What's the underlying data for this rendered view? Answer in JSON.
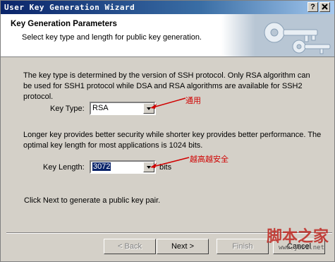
{
  "window": {
    "title": "User Key Generation Wizard",
    "help_btn": "?",
    "close_btn": "X"
  },
  "header": {
    "title": "Key Generation Parameters",
    "subtitle": "Select key type and length for public key generation."
  },
  "content": {
    "paragraph1": "The key type is determined by the version of SSH protocol. Only RSA algorithm can be used for SSH1 protocol while DSA and RSA algorithms are available for SSH2 protocol.",
    "key_type_label": "Key Type:",
    "key_type_value": "RSA",
    "annotation1": "通用",
    "paragraph2": "Longer key provides better security while shorter key provides better performance. The optimal key length for most applications is 1024 bits.",
    "key_length_label": "Key Length:",
    "key_length_value": "3072",
    "key_length_unit": "bits",
    "annotation2": "越高越安全",
    "footer_text": "Click Next to generate a public key pair."
  },
  "buttons": {
    "back": "< Back",
    "next": "Next >",
    "finish": "Finish",
    "cancel": "Cancel"
  },
  "watermark": {
    "text": "脚本之家",
    "url": "www.jb51.net"
  },
  "colors": {
    "annotation": "#d00000",
    "title_bar": "#0a246a",
    "selection": "#0a246a"
  }
}
